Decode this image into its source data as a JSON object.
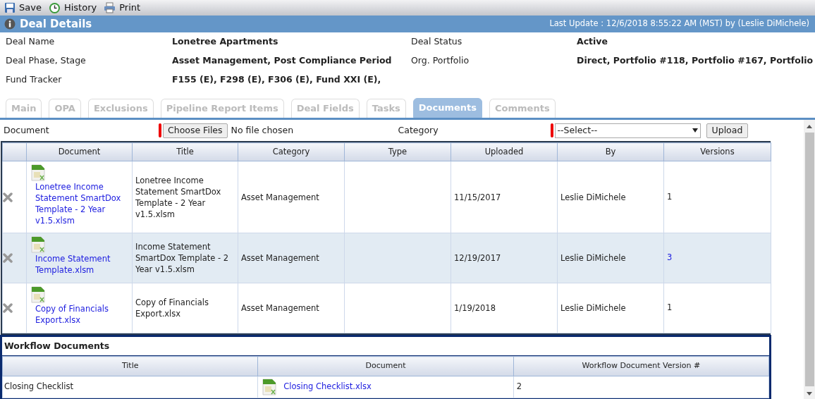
{
  "toolbar": [
    {
      "kind": "save",
      "label": "Save"
    },
    {
      "kind": "history",
      "label": "History"
    },
    {
      "kind": "print",
      "label": "Print"
    }
  ],
  "header": {
    "title": "Deal Details",
    "last_update": "Last Update : 12/6/2018 8:55:22 AM (MST) by (Leslie DiMichele)"
  },
  "details": [
    {
      "label": "Deal Name",
      "value": "Lonetree Apartments"
    },
    {
      "label": "Deal Status",
      "value": "Active"
    },
    {
      "label": "Deal Phase, Stage",
      "value": "Asset Management, Post Compliance Period"
    },
    {
      "label": "Org. Portfolio",
      "value": "Direct, Portfolio #118, Portfolio #167, Portfolio"
    },
    {
      "label": "Fund Tracker",
      "value": "F155 (E), F298 (E), F306 (E), Fund XXI (E),"
    }
  ],
  "tabs": [
    {
      "label": "Main",
      "selected": false
    },
    {
      "label": "OPA",
      "selected": false
    },
    {
      "label": "Exclusions",
      "selected": false
    },
    {
      "label": "Pipeline Report Items",
      "selected": false
    },
    {
      "label": "Deal Fields",
      "selected": false
    },
    {
      "label": "Tasks",
      "selected": false
    },
    {
      "label": "Documents",
      "selected": true
    },
    {
      "label": "Comments",
      "selected": false
    }
  ],
  "upload": {
    "document_label": "Document",
    "document_required": true,
    "choose_button": "Choose Files",
    "file_status": "No file chosen",
    "category_label": "Category",
    "category_required": true,
    "category_value": "--Select--",
    "upload_button": "Upload"
  },
  "documents": {
    "columns": [
      "Document",
      "Title",
      "Category",
      "Type",
      "Uploaded",
      "By",
      "Versions"
    ],
    "rows": [
      {
        "document": "Lonetree Income Statement SmartDox Template - 2 Year v1.5.xlsm",
        "title": "Lonetree Income Statement SmartDox Template - 2 Year v1.5.xlsm",
        "category": "Asset Management",
        "uploaded": "11/15/2017",
        "by": "Leslie DiMichele",
        "versions": "1",
        "versions_link": false
      },
      {
        "document": "Income Statement Template.xlsm",
        "title": "Income Statement SmartDox Template - 2 Year v1.5.xlsm",
        "category": "Asset Management",
        "uploaded": "12/19/2017",
        "by": "Leslie DiMichele",
        "versions": "3",
        "versions_link": true
      },
      {
        "document": "Copy of Financials Export.xlsx",
        "title": "Copy of Financials Export.xlsx",
        "category": "Asset Management",
        "uploaded": "1/19/2018",
        "by": "Leslie DiMichele",
        "versions": "1",
        "versions_link": false
      }
    ]
  },
  "workflow": {
    "title": "Workflow Documents",
    "columns": [
      "Title",
      "Document",
      "Workflow Document Version #"
    ],
    "rows": [
      {
        "title": "Closing Checklist",
        "document": "Closing Checklist.xlsx",
        "version": "2"
      }
    ]
  }
}
